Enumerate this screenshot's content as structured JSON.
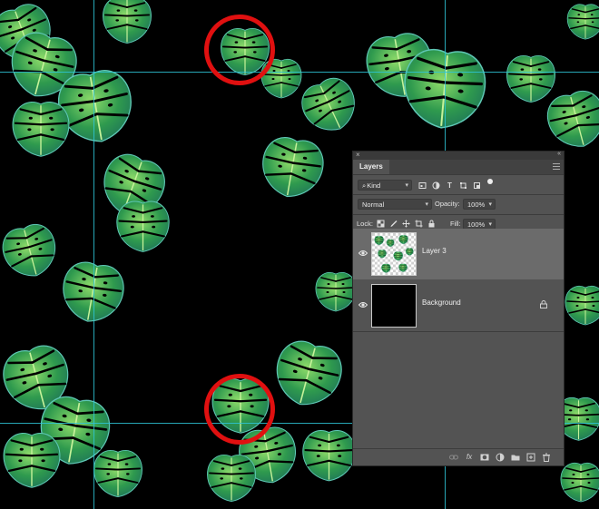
{
  "panel": {
    "tab_label": "Layers",
    "close_glyph": "×",
    "collapse_glyph": "«",
    "filter": {
      "value": "Kind",
      "icon": "search-icon"
    },
    "blend_mode": {
      "value": "Normal"
    },
    "opacity": {
      "label": "Opacity:",
      "value": "100%"
    },
    "lock": {
      "label": "Lock:"
    },
    "fill": {
      "label": "Fill:",
      "value": "100%"
    },
    "layers": [
      {
        "name": "Layer 3",
        "selected": true,
        "visible": true
      },
      {
        "name": "Background",
        "selected": false,
        "visible": true,
        "locked": true
      }
    ],
    "footer_icons": [
      "link-icon",
      "fx-icon",
      "mask-icon",
      "adjustment-icon",
      "group-folder-icon",
      "new-layer-icon",
      "trash-icon"
    ],
    "fx_label": "fx"
  },
  "colors": {
    "panel_bg": "#535353",
    "selected_layer_bg": "#6b6b6b",
    "guide": "#2ec4d6",
    "highlight_ring": "#e01010",
    "canvas_bg": "#000000"
  }
}
